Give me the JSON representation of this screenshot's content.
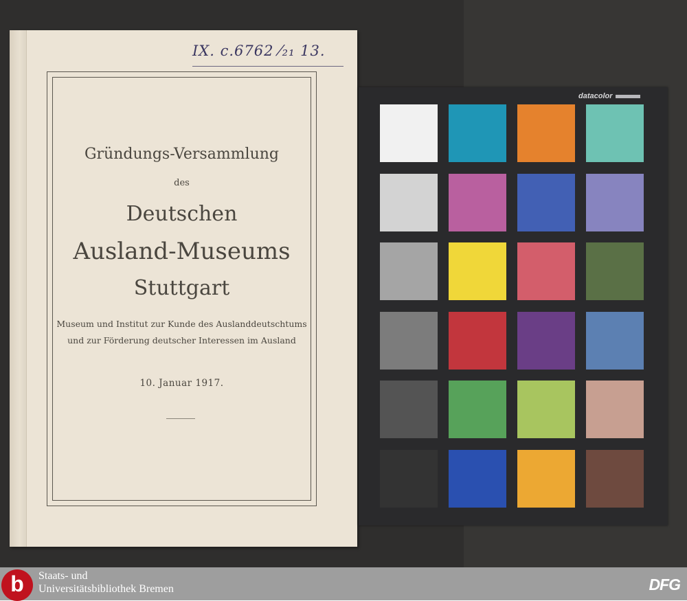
{
  "document": {
    "call_number": "IX. c.6762 ⁄₂₁ 13.",
    "title_line1": "Gründungs-Versammlung",
    "title_des": "des",
    "title_deutschen": "Deutschen",
    "title_ausland_museums": "Ausland-Museums",
    "title_stuttgart": "Stuttgart",
    "subtitle_line1": "Museum und Institut zur Kunde des Auslanddeutschtums",
    "subtitle_line2": "und zur Förderung deutscher Interessen im Ausland",
    "date": "10. Januar 1917."
  },
  "color_checker": {
    "brand": "datacolor",
    "patches": [
      [
        "#f1f1f1",
        "#1f96b6",
        "#e5822d",
        "#6ec2b3"
      ],
      [
        "#d3d3d3",
        "#b9609f",
        "#4260b4",
        "#8784bf"
      ],
      [
        "#a5a5a5",
        "#f0d739",
        "#d35e6b",
        "#5a7046"
      ],
      [
        "#7c7c7c",
        "#c2363d",
        "#6a3e86",
        "#5c80b2"
      ],
      [
        "#545454",
        "#57a25a",
        "#a8c55f",
        "#c79f91"
      ],
      [
        "#333333",
        "#2a50b0",
        "#eca833",
        "#6e4a3f"
      ]
    ]
  },
  "footer": {
    "logo_letter": "b",
    "library_line1": "Staats- und",
    "library_line2": "Universitätsbibliothek Bremen",
    "dfg": "DFG"
  }
}
